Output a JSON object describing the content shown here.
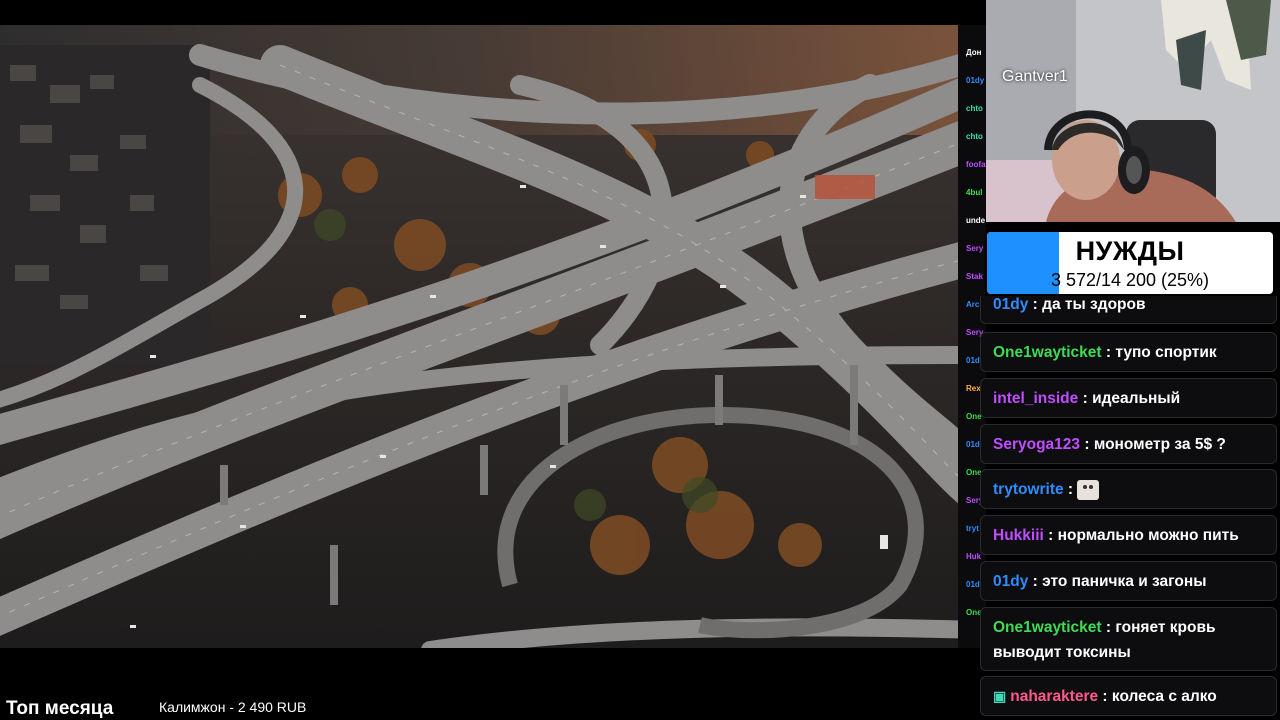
{
  "webcam": {
    "streamer_name": "Gantver1"
  },
  "goal": {
    "title": "НУЖДЫ",
    "progress_text": "3 572/14 200 (25%)",
    "progress_fraction": 0.25,
    "fill_color": "#1e90ff"
  },
  "underlay_chat": {
    "lines": [
      {
        "text": "Дон",
        "color": "#ffffff"
      },
      {
        "text": "01dy",
        "color": "#2f8cff"
      },
      {
        "text": "chto",
        "color": "#34e0b0"
      },
      {
        "text": "chto",
        "color": "#34e0b0"
      },
      {
        "text": "foofa",
        "color": "#c04dff"
      },
      {
        "text": "4bul",
        "color": "#3ddc52"
      },
      {
        "text": "unde",
        "color": "#ffffff"
      },
      {
        "text": "Sery",
        "color": "#c04dff"
      },
      {
        "text": "Stak",
        "color": "#c04dff"
      },
      {
        "text": "Arch",
        "color": "#2f8cff"
      },
      {
        "text": "Sery",
        "color": "#c04dff"
      },
      {
        "text": "01dy",
        "color": "#2f8cff"
      },
      {
        "text": "Rext",
        "color": "#ffb347"
      },
      {
        "text": "One",
        "color": "#3ddc52"
      },
      {
        "text": "01dy",
        "color": "#2f8cff"
      },
      {
        "text": "One",
        "color": "#3ddc52"
      },
      {
        "text": "Sery",
        "color": "#c04dff"
      },
      {
        "text": "tryt",
        "color": "#2f8cff"
      },
      {
        "text": "Huk",
        "color": "#c04dff"
      },
      {
        "text": "01dy",
        "color": "#2f8cff"
      },
      {
        "text": "One",
        "color": "#3ddc52"
      }
    ]
  },
  "chat": {
    "messages": [
      {
        "user": "01dy",
        "user_color": "#2f8cff",
        "text": "да ты здоров"
      },
      {
        "user": "One1wayticket",
        "user_color": "#3ddc52",
        "text": "тупо спортик"
      },
      {
        "user": "intel_inside",
        "user_color": "#c04dff",
        "text": "идеальный"
      },
      {
        "user": "Seryoga123",
        "user_color": "#c04dff",
        "text": "монометр за 5$ ?"
      },
      {
        "user": "trytowrite",
        "user_color": "#2f8cff",
        "text": ""
      },
      {
        "user": "Hukkiii",
        "user_color": "#c04dff",
        "text": "нормально можно пить"
      },
      {
        "user": "01dy",
        "user_color": "#2f8cff",
        "text": "это паничка и загоны"
      },
      {
        "user": "One1wayticket",
        "user_color": "#3ddc52",
        "text": "гоняет кровь",
        "text2": "выводит токсины"
      },
      {
        "user": "naharaktere",
        "user_color": "#ff5a8a",
        "text": "колеса с алко"
      }
    ]
  },
  "bottom": {
    "top_title": "Топ месяца",
    "top_donor": "Калимжон - 2 490 RUB"
  }
}
